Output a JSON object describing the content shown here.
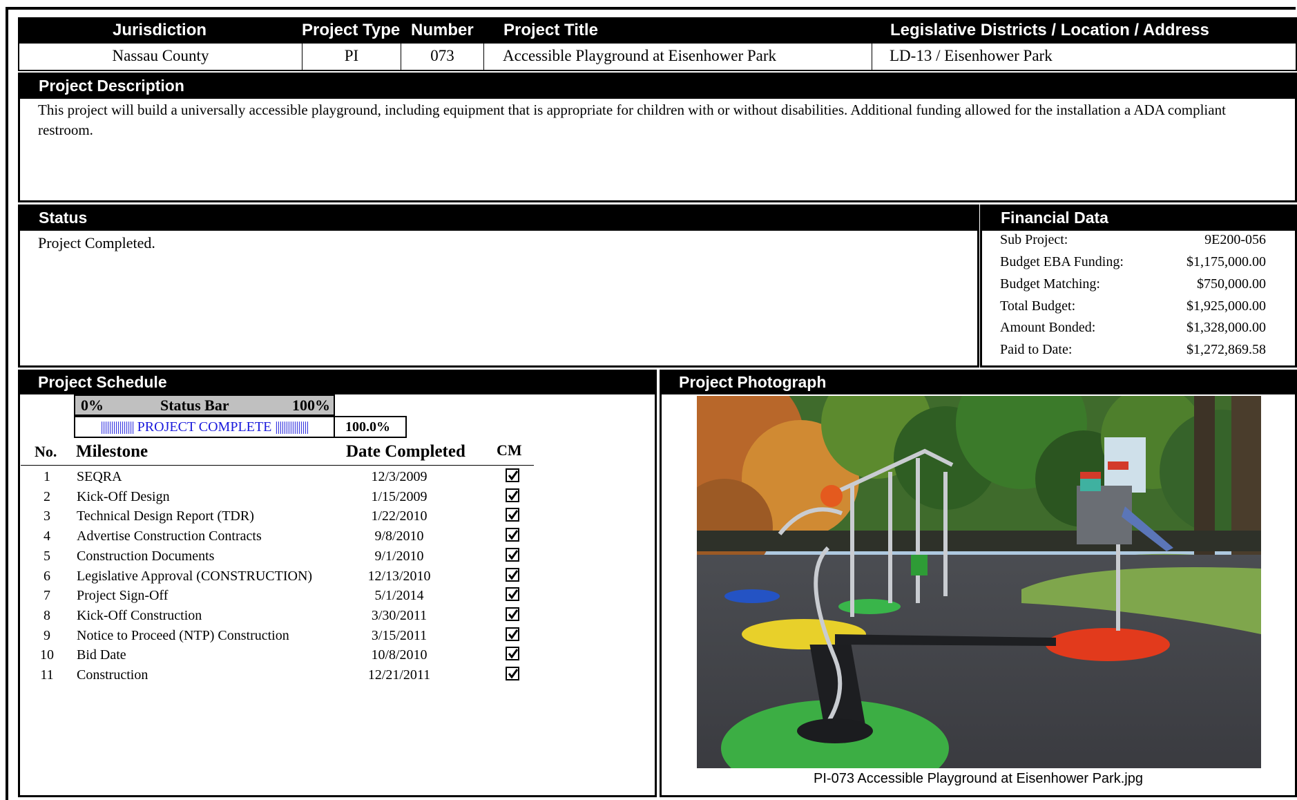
{
  "header": {
    "columns": [
      "Jurisdiction",
      "Project Type",
      "Number",
      "Project Title",
      "Legislative Districts / Location / Address"
    ],
    "values": [
      "Nassau County",
      "PI",
      "073",
      "Accessible Playground at Eisenhower Park",
      "LD-13 / Eisenhower Park"
    ]
  },
  "description": {
    "title": "Project Description",
    "text": "This project will build a universally accessible playground, including equipment that is appropriate for children with or without disabilities. Additional funding allowed for the installation a ADA compliant restroom."
  },
  "status": {
    "title": "Status",
    "text": "Project Completed."
  },
  "financial": {
    "title": "Financial Data",
    "rows": [
      {
        "label": "Sub Project:",
        "value": "9E200-056"
      },
      {
        "label": "Budget EBA Funding:",
        "value": "$1,175,000.00"
      },
      {
        "label": "Budget Matching:",
        "value": "$750,000.00"
      },
      {
        "label": "Total Budget:",
        "value": "$1,925,000.00"
      },
      {
        "label": "Amount Bonded:",
        "value": "$1,328,000.00"
      },
      {
        "label": "Paid to Date:",
        "value": "$1,272,869.58"
      }
    ]
  },
  "schedule": {
    "title": "Project Schedule",
    "status_bar": {
      "min_label": "0%",
      "label": "Status Bar",
      "max_label": "100%",
      "bar_text": "PROJECT COMPLETE",
      "percent_text": "100.0%",
      "progress": 1.0
    },
    "columns": {
      "no": "No.",
      "milestone": "Milestone",
      "date": "Date Completed",
      "cm": "CM"
    },
    "milestones": [
      {
        "no": "1",
        "name": "SEQRA",
        "date": "12/3/2009",
        "cm": true
      },
      {
        "no": "2",
        "name": "Kick-Off Design",
        "date": "1/15/2009",
        "cm": true
      },
      {
        "no": "3",
        "name": "Technical Design Report (TDR)",
        "date": "1/22/2010",
        "cm": true
      },
      {
        "no": "4",
        "name": "Advertise Construction Contracts",
        "date": "9/8/2010",
        "cm": true
      },
      {
        "no": "5",
        "name": "Construction Documents",
        "date": "9/1/2010",
        "cm": true
      },
      {
        "no": "6",
        "name": "Legislative Approval (CONSTRUCTION)",
        "date": "12/13/2010",
        "cm": true
      },
      {
        "no": "7",
        "name": "Project Sign-Off",
        "date": "5/1/2014",
        "cm": true
      },
      {
        "no": "8",
        "name": "Kick-Off Construction",
        "date": "3/30/2011",
        "cm": true
      },
      {
        "no": "9",
        "name": "Notice to Proceed (NTP) Construction",
        "date": "3/15/2011",
        "cm": true
      },
      {
        "no": "10",
        "name": "Bid Date",
        "date": "10/8/2010",
        "cm": true
      },
      {
        "no": "11",
        "name": "Construction",
        "date": "12/21/2011",
        "cm": true
      }
    ]
  },
  "photo": {
    "title": "Project Photograph",
    "caption": "PI-073 Accessible Playground at Eisenhower Park.jpg"
  }
}
